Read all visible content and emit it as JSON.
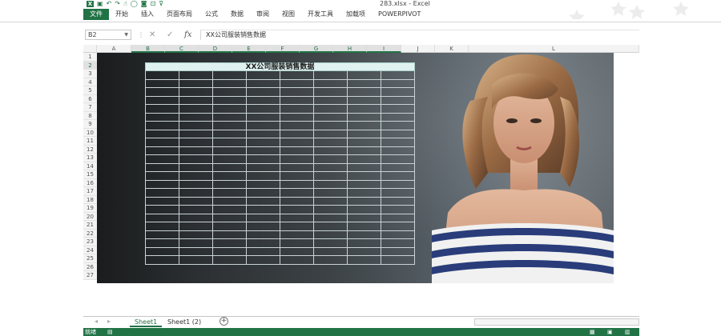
{
  "window": {
    "title": "283.xlsx - Excel"
  },
  "ribbon": {
    "tabs": [
      "文件",
      "开始",
      "插入",
      "页面布局",
      "公式",
      "数据",
      "审阅",
      "视图",
      "开发工具",
      "加载项",
      "POWERPIVOT"
    ]
  },
  "formula_bar": {
    "name_box": "B2",
    "content": "XX公司服装销售数据"
  },
  "columns": [
    "A",
    "B",
    "C",
    "D",
    "E",
    "F",
    "G",
    "H",
    "I",
    "J",
    "K",
    "L"
  ],
  "rows": [
    "1",
    "2",
    "3",
    "4",
    "5",
    "6",
    "7",
    "8",
    "9",
    "10",
    "11",
    "12",
    "13",
    "14",
    "15",
    "16",
    "17",
    "18",
    "19",
    "20",
    "21",
    "22",
    "23",
    "24",
    "25",
    "26",
    "27"
  ],
  "table": {
    "title": "XX公司服装销售数据"
  },
  "sheets": [
    {
      "name": "Sheet1",
      "active": true
    },
    {
      "name": "Sheet1 (2)",
      "active": false
    }
  ],
  "status": {
    "ready": "就绪"
  },
  "colors": {
    "accent": "#217346"
  }
}
